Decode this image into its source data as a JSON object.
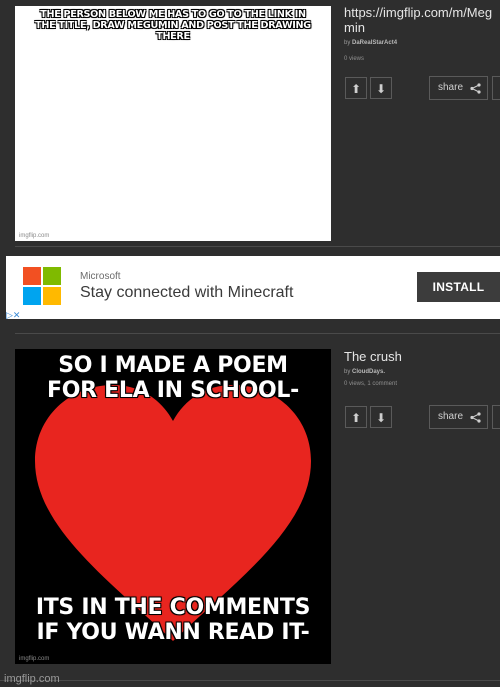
{
  "posts": [
    {
      "caption": "The person below me has to go to the link in the title, draw Megumin and post the drawing there",
      "watermark": "imgflip.com",
      "title": "https://imgflip.com/m/Meg\nmin",
      "by_prefix": "by",
      "author": "DaRealStarAct4",
      "stats": "0 views",
      "share_label": "share"
    },
    {
      "caption_top": "SO I MADE A POEM FOR ELA IN SCHOOL-",
      "caption_bottom": "ITS IN THE COMMENTS IF YOU WANN READ IT-",
      "watermark": "imgflip.com",
      "title": "The crush",
      "by_prefix": "by",
      "author": "CloudDays.",
      "stats": "0 views, 1 comment",
      "share_label": "share"
    }
  ],
  "ad": {
    "brand": "Microsoft",
    "text": "Stay connected with Minecraft",
    "install_label": "INSTALL",
    "choices": "▷✕"
  },
  "footer_watermark": "imgflip.com",
  "colors": {
    "background": "#2e2e2e",
    "heart": "#e8251f",
    "ms_red": "#f25022",
    "ms_green": "#7fba00",
    "ms_blue": "#00a4ef",
    "ms_yellow": "#ffb900"
  }
}
